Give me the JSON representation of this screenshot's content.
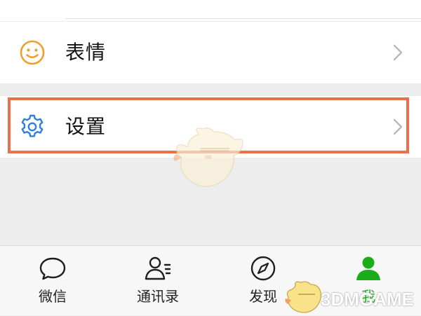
{
  "rows": [
    {
      "label": "表情",
      "icon": "emoji-icon",
      "icon_color": "#f0a02a"
    },
    {
      "label": "设置",
      "icon": "gear-icon",
      "icon_color": "#2f7fd6"
    }
  ],
  "tabs": [
    {
      "label": "微信",
      "icon": "chat-bubble-icon"
    },
    {
      "label": "通讯录",
      "icon": "contacts-icon"
    },
    {
      "label": "发现",
      "icon": "compass-icon"
    },
    {
      "label": "我",
      "icon": "person-icon",
      "active": true
    }
  ],
  "colors": {
    "highlight": "#e8704a",
    "active_tab": "#1aad19",
    "background": "#ededed"
  },
  "watermark": {
    "text": "3DMGAME"
  }
}
